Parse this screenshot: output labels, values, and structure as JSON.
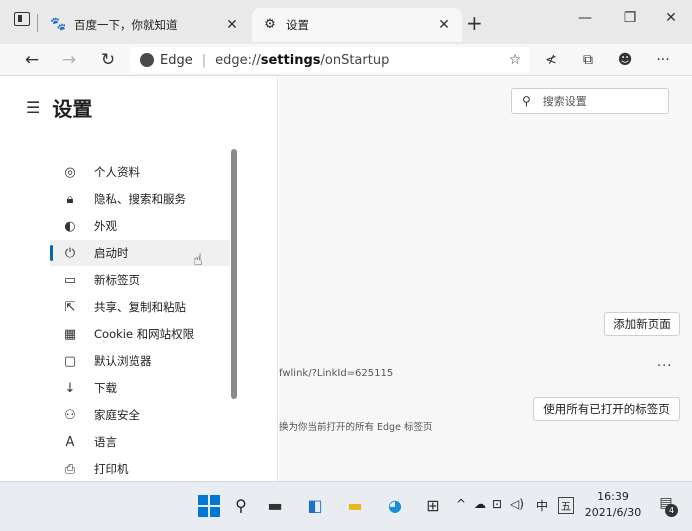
{
  "browser": {
    "tabs": [
      {
        "title": "百度一下，你就知道",
        "favicon": "baidu-paw-icon",
        "active": false
      },
      {
        "title": "设置",
        "favicon": "gear-icon",
        "active": true
      }
    ],
    "omnibox": {
      "brand": "Edge",
      "url_prefix": "edge://",
      "url_bold": "settings",
      "url_suffix": "/onStartup"
    }
  },
  "settings": {
    "title": "设置",
    "search_placeholder": "搜索设置",
    "nav": [
      {
        "label": "个人资料",
        "icon": "profile-icon"
      },
      {
        "label": "隐私、搜索和服务",
        "icon": "lock-icon"
      },
      {
        "label": "外观",
        "icon": "palette-icon"
      },
      {
        "label": "启动时",
        "icon": "power-icon",
        "active": true
      },
      {
        "label": "新标签页",
        "icon": "new-tab-icon"
      },
      {
        "label": "共享、复制和粘贴",
        "icon": "share-icon"
      },
      {
        "label": "Cookie 和网站权限",
        "icon": "cookie-icon"
      },
      {
        "label": "默认浏览器",
        "icon": "browser-icon"
      },
      {
        "label": "下载",
        "icon": "download-icon"
      },
      {
        "label": "家庭安全",
        "icon": "family-icon"
      },
      {
        "label": "语言",
        "icon": "language-icon"
      },
      {
        "label": "打印机",
        "icon": "printer-icon"
      }
    ],
    "add_page_button": "添加新页面",
    "use_all_tabs_button": "使用所有已打开的标签页",
    "url_fragment": "fwlink/?LinkId=625115",
    "desc_fragment": "换为你当前打开的所有 Edge 标签页",
    "more_label": "···"
  },
  "taskbar": {
    "ime": "中",
    "ime_mode": "五",
    "time": "16:39",
    "date": "2021/6/30",
    "notification_count": "4"
  },
  "colors": {
    "accent": "#0067c0",
    "tabstrip": "#e9e9ea",
    "content_bg": "#f7f7f7"
  }
}
